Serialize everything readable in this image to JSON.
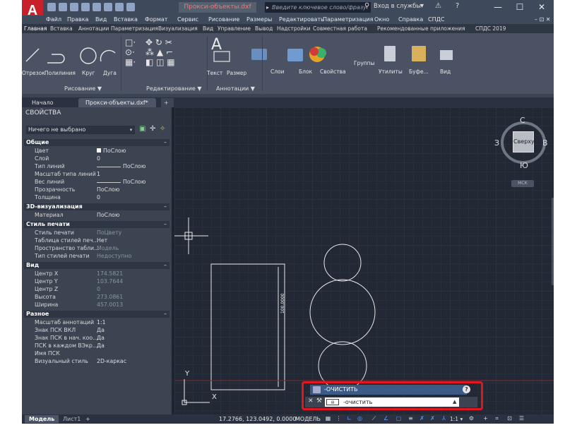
{
  "app": {
    "logo": "A",
    "file_title": "Прокси-объекты.dxf",
    "search_placeholder": "Введите ключевое слово/фразу",
    "sign_in": "Вход в службы",
    "minimize": "—",
    "maximize": "☐",
    "close": "✕"
  },
  "menu": [
    "Файл",
    "Правка",
    "Вид",
    "Вставка",
    "Формат",
    "Сервис",
    "Рисование",
    "Размеры",
    "Редактировать",
    "Параметризация",
    "Окно",
    "Справка",
    "СПДС"
  ],
  "ribbon_tabs": [
    "Главная",
    "Вставка",
    "Аннотации",
    "Параметризация",
    "Визуализация",
    "Вид",
    "Управление",
    "Вывод",
    "Надстройки",
    "Совместная работа",
    "Рекомендованные приложения",
    "СПДС 2019"
  ],
  "ribbon": {
    "draw_tools": [
      "Отрезок",
      "Полилиния",
      "Круг",
      "Дуга"
    ],
    "text_tool": "Текст",
    "dim_tool": "Размер",
    "layers": "Слои",
    "block": "Блок",
    "properties": "Свойства",
    "groups": "Группы",
    "utilities": "Утилиты",
    "clipboard": "Буфе...",
    "view": "Вид",
    "panel_draw": "Рисование ▼",
    "panel_modify": "Редактирование ▼",
    "panel_annotation": "Аннотации ▼"
  },
  "doc_tabs": {
    "start": "Начало",
    "document": "Прокси-объекты.dxf*",
    "close": "✕",
    "add": "+"
  },
  "properties": {
    "title": "СВОЙСТВА",
    "selection": "Ничего не выбрано",
    "sections": [
      {
        "name": "Общие",
        "rows": [
          {
            "k": "Цвет",
            "v": "ПоСлою"
          },
          {
            "k": "Слой",
            "v": "0"
          },
          {
            "k": "Тип линий",
            "v": "ПоСлою"
          },
          {
            "k": "Масштаб типа линий",
            "v": "1"
          },
          {
            "k": "Вес линий",
            "v": "ПоСлою"
          },
          {
            "k": "Прозрачность",
            "v": "ПоСлою"
          },
          {
            "k": "Толщина",
            "v": "0"
          }
        ]
      },
      {
        "name": "3D-визуализация",
        "rows": [
          {
            "k": "Материал",
            "v": "ПоСлою"
          }
        ]
      },
      {
        "name": "Стиль печати",
        "rows": [
          {
            "k": "Стиль печати",
            "v": "ПоЦвету"
          },
          {
            "k": "Таблица стилей печ...",
            "v": "Нет"
          },
          {
            "k": "Пространство табли...",
            "v": "Модель"
          },
          {
            "k": "Тип стилей печати",
            "v": "Недоступно"
          }
        ]
      },
      {
        "name": "Вид",
        "rows": [
          {
            "k": "Центр X",
            "v": "174.5821"
          },
          {
            "k": "Центр Y",
            "v": "103.7644"
          },
          {
            "k": "Центр Z",
            "v": "0"
          },
          {
            "k": "Высота",
            "v": "273.0861"
          },
          {
            "k": "Ширина",
            "v": "457.0013"
          }
        ]
      },
      {
        "name": "Разное",
        "rows": [
          {
            "k": "Масштаб аннотаций",
            "v": "1:1"
          },
          {
            "k": "Знак ПСК ВКЛ",
            "v": "Да"
          },
          {
            "k": "Знак ПСК в нач. коо...",
            "v": "Да"
          },
          {
            "k": "ПСК в каждом ВЭкр...",
            "v": "Да"
          },
          {
            "k": "Имя ПСК",
            "v": ""
          },
          {
            "k": "Визуальный стиль",
            "v": "2D-каркас"
          }
        ]
      }
    ]
  },
  "viewcube": {
    "north": "С",
    "west": "З",
    "east": "В",
    "south": "Ю",
    "face": "Сверху",
    "ucs": "МСК"
  },
  "drawing": {
    "dimension": "100.0000",
    "axis_y": "Y",
    "axis_x": "X"
  },
  "command": {
    "history": "-ОЧИСТИТЬ",
    "input_value": "-очистить",
    "help": "?"
  },
  "status": {
    "layout_model": "Модель",
    "layout_sheet": "Лист1",
    "add": "+",
    "coords": "17.2766, 123.0492, 0.0000",
    "model": "МОДЕЛЬ",
    "scale": "1:1 ▾"
  },
  "colors": {
    "accent_red": "#e0171f",
    "canvas": "#222935",
    "panel": "#3c4452"
  }
}
